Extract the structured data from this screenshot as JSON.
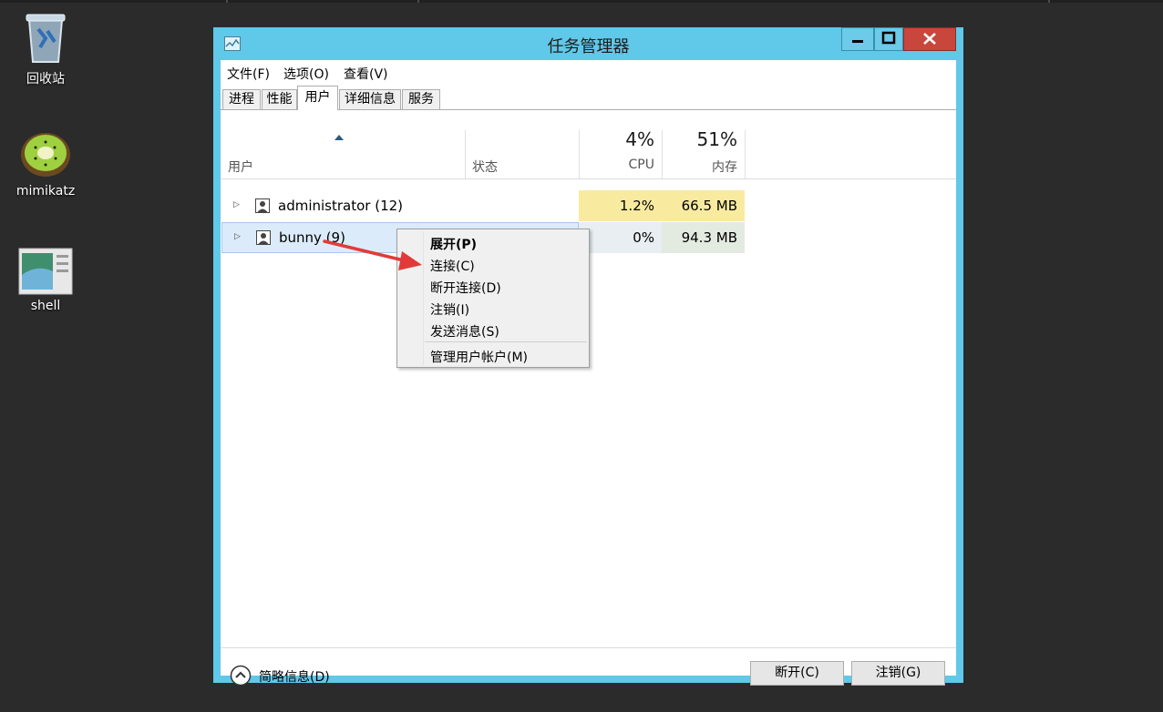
{
  "desktop": {
    "icons": [
      {
        "label": "回收站",
        "icon": "recycle-bin-icon"
      },
      {
        "label": "mimikatz",
        "icon": "kiwi-icon"
      },
      {
        "label": "shell",
        "icon": "app-window-icon"
      }
    ]
  },
  "window": {
    "title": "任务管理器",
    "controls": {
      "minimize": "minimize-icon",
      "maximize": "maximize-icon",
      "close": "close-icon"
    }
  },
  "menubar": [
    "文件(F)",
    "选项(O)",
    "查看(V)"
  ],
  "tabs": [
    {
      "label": "进程",
      "active": false
    },
    {
      "label": "性能",
      "active": false
    },
    {
      "label": "用户",
      "active": true
    },
    {
      "label": "详细信息",
      "active": false
    },
    {
      "label": "服务",
      "active": false
    }
  ],
  "table": {
    "columns": {
      "user": "用户",
      "status": "状态",
      "cpu_pct": "4%",
      "cpu": "CPU",
      "mem_pct": "51%",
      "mem": "内存"
    },
    "rows": [
      {
        "name": "administrator (12)",
        "status": "",
        "cpu": "1.2%",
        "mem": "66.5 MB"
      },
      {
        "name": "bunny (9)",
        "status": "",
        "cpu": "0%",
        "mem": "94.3 MB"
      }
    ]
  },
  "context_menu": {
    "items": [
      {
        "label": "展开(P)",
        "bold": true
      },
      {
        "label": "连接(C)"
      },
      {
        "label": "断开连接(D)"
      },
      {
        "label": "注销(I)"
      },
      {
        "label": "发送消息(S)"
      },
      {
        "label": "管理用户帐户(M)"
      }
    ]
  },
  "footer": {
    "fewer_details": "简略信息(D)",
    "disconnect": "断开(C)",
    "logoff": "注销(G)"
  },
  "colors": {
    "titlebar": "#60c8e8",
    "close_button": "#c9463d",
    "cpu_highlight": "#f8eba0",
    "row_selected": "#dcebfa",
    "arrow": "#e23a3a"
  }
}
